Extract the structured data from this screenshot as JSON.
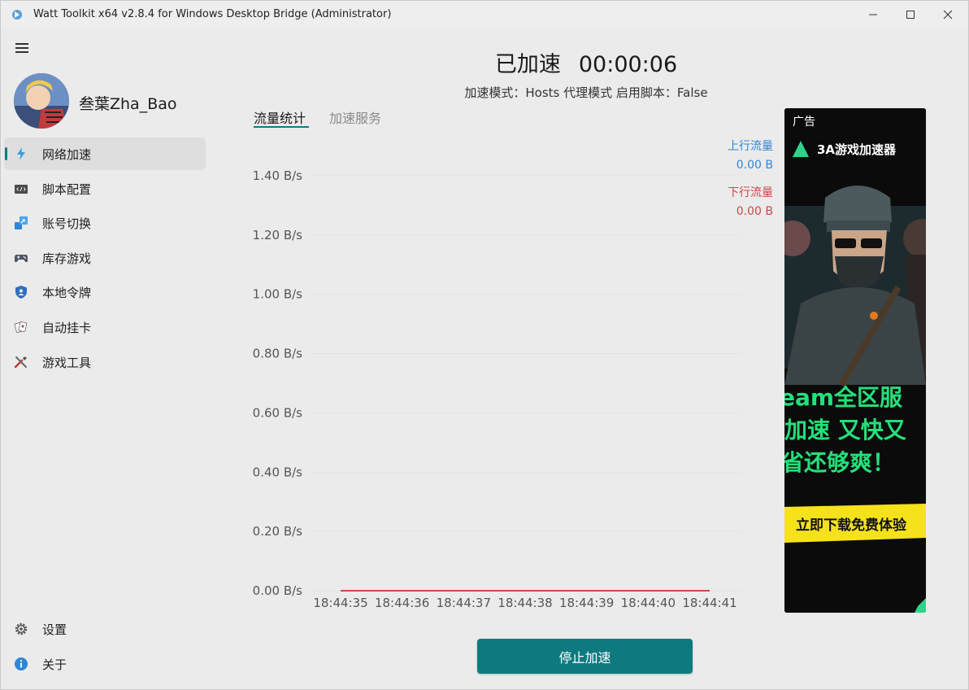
{
  "window": {
    "title": "Watt Toolkit x64 v2.8.4 for Windows Desktop Bridge (Administrator)",
    "minimize": "—",
    "maximize": "☐",
    "close": "✕"
  },
  "user": {
    "name": "叁葉Zha_Bao"
  },
  "sidebar": {
    "items": [
      {
        "label": "网络加速",
        "icon": "lightning-icon",
        "active": true
      },
      {
        "label": "脚本配置",
        "icon": "script-icon"
      },
      {
        "label": "账号切换",
        "icon": "account-switch-icon"
      },
      {
        "label": "库存游戏",
        "icon": "gamepad-icon"
      },
      {
        "label": "本地令牌",
        "icon": "shield-icon"
      },
      {
        "label": "自动挂卡",
        "icon": "cards-icon"
      },
      {
        "label": "游戏工具",
        "icon": "tools-icon"
      }
    ],
    "bottom": [
      {
        "label": "设置",
        "icon": "gear-icon"
      },
      {
        "label": "关于",
        "icon": "info-icon"
      }
    ]
  },
  "status": {
    "state": "已加速",
    "elapsed": "00:00:06",
    "mode_line": "加速模式：Hosts 代理模式   启用脚本：False"
  },
  "tabs": [
    {
      "label": "流量统计",
      "active": true
    },
    {
      "label": "加速服务",
      "active": false
    }
  ],
  "legend": {
    "up_label": "上行流量",
    "up_value": "0.00 B",
    "down_label": "下行流量",
    "down_value": "0.00 B",
    "up_color": "#2f86d6",
    "down_color": "#c94a4a"
  },
  "chart_data": {
    "type": "line",
    "x": [
      "18:44:35",
      "18:44:36",
      "18:44:37",
      "18:44:38",
      "18:44:39",
      "18:44:40",
      "18:44:41"
    ],
    "y_ticks": [
      "0.00 B/s",
      "0.20 B/s",
      "0.40 B/s",
      "0.60 B/s",
      "0.80 B/s",
      "1.00 B/s",
      "1.20 B/s",
      "1.40 B/s"
    ],
    "ylim": [
      0,
      1.4
    ],
    "series": [
      {
        "name": "上行流量",
        "color": "#2f86d6",
        "values": [
          0,
          0,
          0,
          0,
          0,
          0,
          0
        ]
      },
      {
        "name": "下行流量",
        "color": "#c94a4a",
        "values": [
          0,
          0,
          0,
          0,
          0,
          0,
          0
        ]
      }
    ]
  },
  "ad": {
    "tag": "广告",
    "brand": "3A游戏加速器",
    "lines": [
      "eam全区服",
      "加速 又快又",
      "省还够爽！"
    ],
    "cta": "立即下载免费体验"
  },
  "actions": {
    "stop_label": "停止加速"
  }
}
